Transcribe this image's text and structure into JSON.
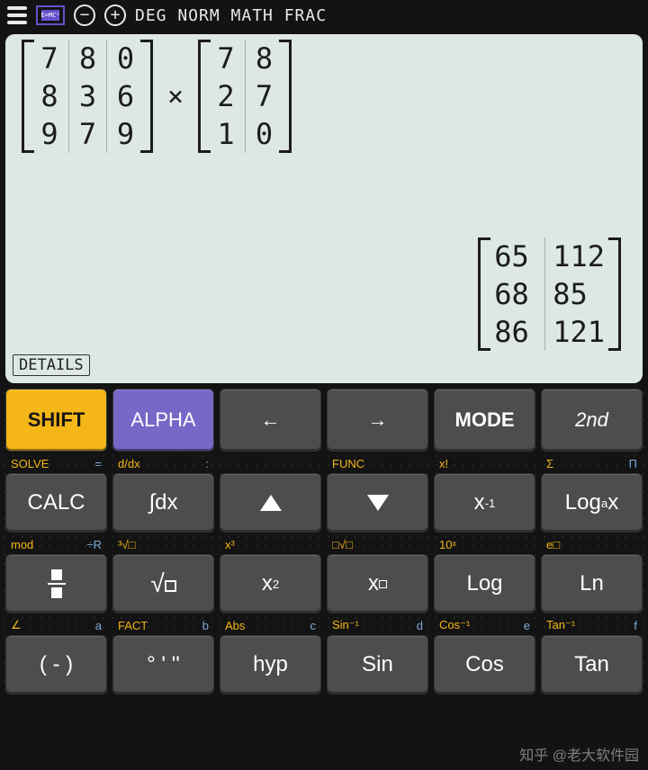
{
  "menubar": {
    "flags": "DEG NORM MATH FRAC"
  },
  "display": {
    "matrixA": [
      [
        "7",
        "8",
        "0"
      ],
      [
        "8",
        "3",
        "6"
      ],
      [
        "9",
        "7",
        "9"
      ]
    ],
    "operator": "×",
    "matrixB": [
      [
        "7",
        "8"
      ],
      [
        "2",
        "7"
      ],
      [
        "1",
        "0"
      ]
    ],
    "result": [
      [
        "65",
        "112"
      ],
      [
        "68",
        "85"
      ],
      [
        "86",
        "121"
      ]
    ],
    "details_label": "DETAILS"
  },
  "keys": {
    "r1": {
      "shift": "SHIFT",
      "alpha": "ALPHA",
      "left": "←",
      "right": "→",
      "mode": "MODE",
      "second": "2nd"
    },
    "labels1": [
      {
        "s": "SOLVE",
        "a": "="
      },
      {
        "s": "d/dx",
        "a": ":"
      },
      {
        "s": "",
        "a": ""
      },
      {
        "s": "FUNC",
        "a": ""
      },
      {
        "s": "x!",
        "a": ""
      },
      {
        "s": "Σ",
        "a": "Π"
      }
    ],
    "r2": {
      "calc": "CALC",
      "int": "∫dx",
      "xinv_base": "x",
      "xinv_exp": "-1",
      "log_base": "Log",
      "log_sub": "a",
      "log_arg": "x"
    },
    "labels2": [
      {
        "s": "mod",
        "a": "÷R"
      },
      {
        "s": "³√□",
        "a": ""
      },
      {
        "s": "x³",
        "a": ""
      },
      {
        "s": "□√□",
        "a": ""
      },
      {
        "s": "10ˣ",
        "a": ""
      },
      {
        "s": "e□",
        "a": ""
      }
    ],
    "r3": {
      "x2_base": "x",
      "x2_exp": "2",
      "xp_base": "x",
      "log": "Log",
      "ln": "Ln"
    },
    "labels3": [
      {
        "s": "∠",
        "a": "a"
      },
      {
        "s": "FACT",
        "a": "b"
      },
      {
        "s": "Abs",
        "a": "c"
      },
      {
        "s": "Sin⁻¹",
        "a": "d"
      },
      {
        "s": "Cos⁻¹",
        "a": "e"
      },
      {
        "s": "Tan⁻¹",
        "a": "f"
      }
    ],
    "r4": {
      "neg": "( - )",
      "dms": "° ' ''",
      "hyp": "hyp",
      "sin": "Sin",
      "cos": "Cos",
      "tan": "Tan"
    }
  },
  "watermark": "@老大软件园"
}
